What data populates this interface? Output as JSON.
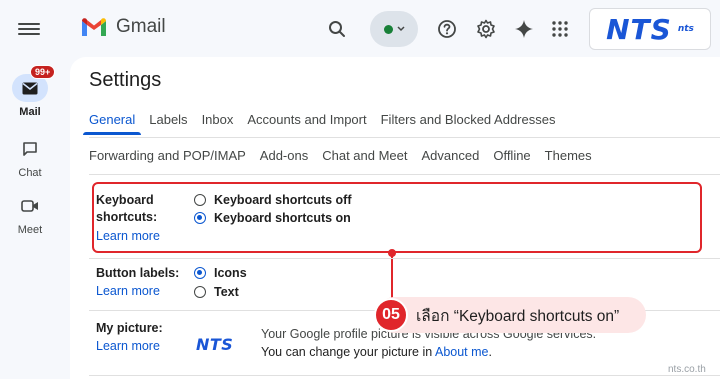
{
  "rail": {
    "items": [
      {
        "label": "Mail",
        "badge": "99+",
        "icon": "mail-icon"
      },
      {
        "label": "Chat",
        "icon": "chat-icon"
      },
      {
        "label": "Meet",
        "icon": "video-icon"
      }
    ]
  },
  "header": {
    "app_name": "Gmail",
    "brand_big": "NTS",
    "brand_small": "nts"
  },
  "settings": {
    "title": "Settings",
    "tabs_row1": [
      "General",
      "Labels",
      "Inbox",
      "Accounts and Import",
      "Filters and Blocked Addresses"
    ],
    "tabs_row2": [
      "Forwarding and POP/IMAP",
      "Add-ons",
      "Chat and Meet",
      "Advanced",
      "Offline",
      "Themes"
    ],
    "active_tab": "General",
    "keyboard": {
      "label_line1": "Keyboard",
      "label_line2": "shortcuts:",
      "learn_more": "Learn more",
      "opt_off": "Keyboard shortcuts off",
      "opt_on": "Keyboard shortcuts on",
      "selected": "on"
    },
    "button_labels": {
      "label": "Button labels:",
      "learn_more": "Learn more",
      "opt_icons": "Icons",
      "opt_text": "Text",
      "selected": "icons"
    },
    "picture": {
      "label": "My picture:",
      "learn_more": "Learn more",
      "logo_text": "NTS",
      "line1": "Your Google profile picture is visible across Google services.",
      "line2_prefix": "You can change your picture in",
      "line2_link": "About me",
      "line2_suffix": "."
    }
  },
  "callout": {
    "step": "05",
    "text": "เลือก “Keyboard shortcuts on”"
  },
  "watermark": "nts.co.th",
  "colors": {
    "accent": "#0b57d0",
    "highlight": "#e0262b",
    "callout_bg": "#fde6e6",
    "brand": "#1a56d6"
  }
}
